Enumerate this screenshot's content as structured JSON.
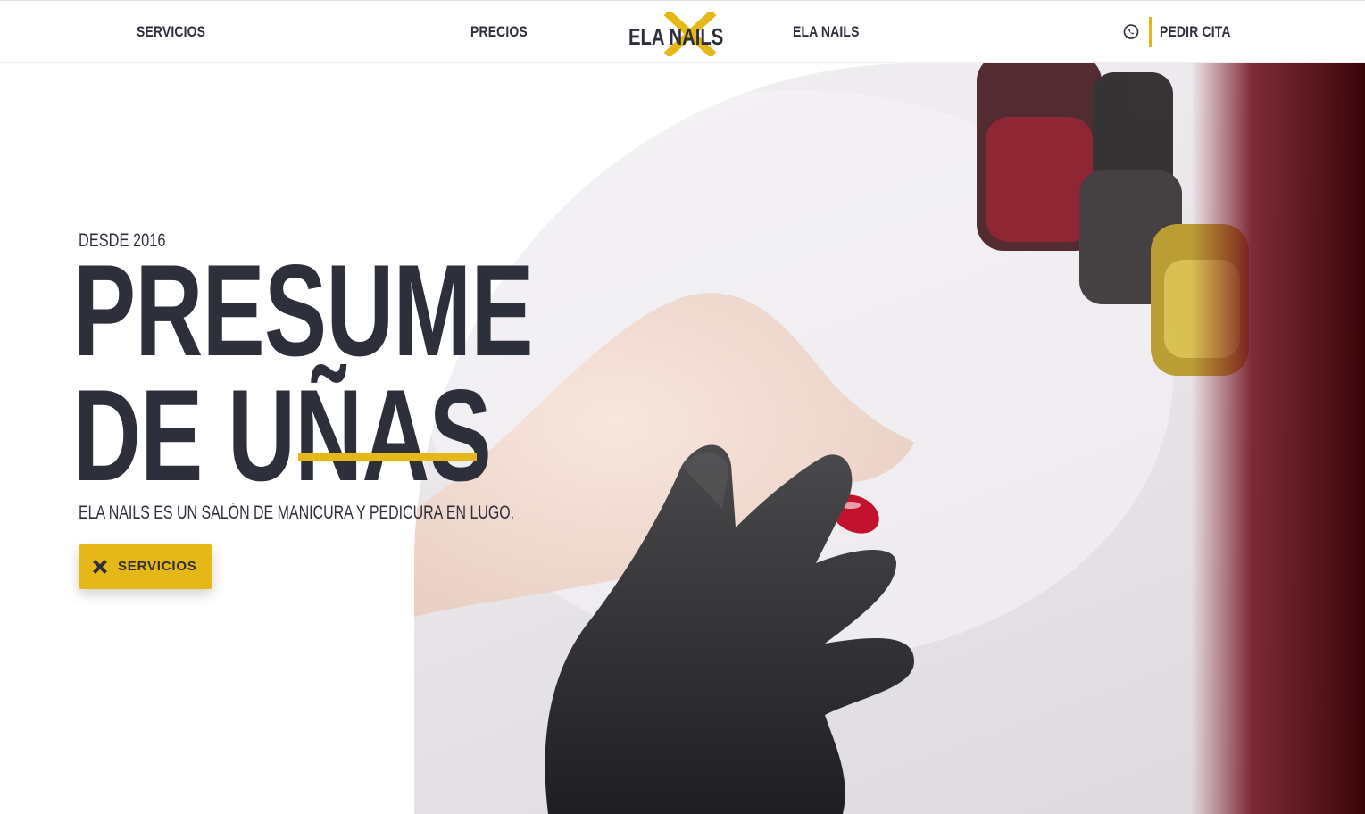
{
  "header": {
    "nav": [
      "SERVICIOS",
      "PRECIOS",
      "ELA NAILS"
    ],
    "logo_text": "ELA NAILS",
    "cta_label": "PEDIR CITA",
    "cta_icon": "whatsapp-icon"
  },
  "hero": {
    "eyebrow": "DESDE 2016",
    "headline_line1": "PRESUME",
    "headline_line2": "DE UÑAS",
    "tagline": "ELA NAILS ES UN SALÓN DE MANICURA Y PEDICURA EN LUGO.",
    "button_label": "SERVICIOS",
    "button_icon": "close-x-icon"
  },
  "colors": {
    "accent": "#e6b817",
    "text": "#2d2f3a",
    "background": "#ffffff"
  }
}
